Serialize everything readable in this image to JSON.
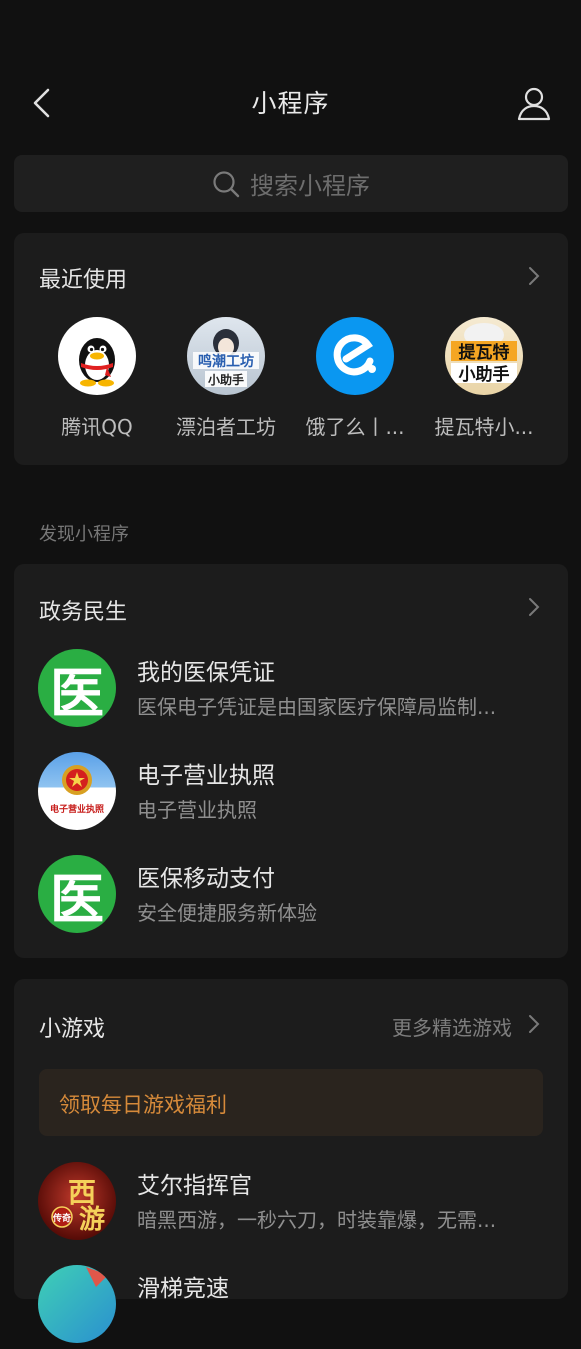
{
  "header": {
    "title": "小程序"
  },
  "search": {
    "placeholder": "搜索小程序"
  },
  "recent": {
    "title": "最近使用",
    "items": [
      {
        "label": "腾讯QQ",
        "icon": "qq-penguin-icon"
      },
      {
        "label": "漂泊者工坊",
        "icon": "wanderer-workshop-icon",
        "icon_text": [
          "鸣潮工坊",
          "小助手"
        ]
      },
      {
        "label": "饿了么丨...",
        "icon": "eleme-icon"
      },
      {
        "label": "提瓦特小...",
        "icon": "teyvat-helper-icon",
        "icon_text": [
          "提瓦特",
          "小助手"
        ]
      }
    ]
  },
  "discover_label": "发现小程序",
  "gov": {
    "title": "政务民生",
    "items": [
      {
        "name": "我的医保凭证",
        "desc": "医保电子凭证是由国家医疗保障局监制...",
        "icon": "medical-insurance-icon",
        "icon_text": "医"
      },
      {
        "name": "电子营业执照",
        "desc": "电子营业执照",
        "icon": "business-license-icon",
        "icon_text": "电子营业执照"
      },
      {
        "name": "医保移动支付",
        "desc": "安全便捷服务新体验",
        "icon": "medical-insurance-icon",
        "icon_text": "医"
      }
    ]
  },
  "games": {
    "title": "小游戏",
    "more": "更多精选游戏",
    "banner": "领取每日游戏福利",
    "items": [
      {
        "name": "艾尔指挥官",
        "desc": "暗黑西游，一秒六刀，时装靠爆，无需...",
        "icon": "xiyou-game-icon",
        "icon_text": [
          "西",
          "游",
          "传奇"
        ]
      },
      {
        "name": "滑梯竞速",
        "desc": "",
        "icon": "slide-race-icon"
      }
    ]
  },
  "colors": {
    "background": "#111111",
    "card": "#1c1c1c",
    "accent_green": "#2aae43",
    "banner_text": "#d68a3a",
    "eleme_blue": "#0a97f1"
  }
}
